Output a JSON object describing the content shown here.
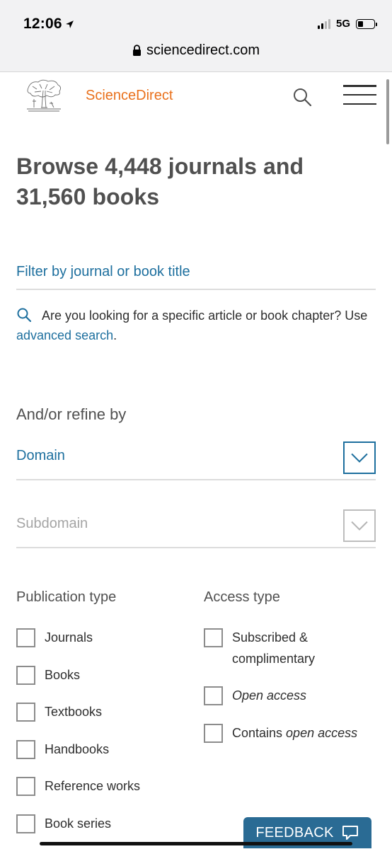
{
  "status_bar": {
    "time": "12:06",
    "network": "5G"
  },
  "browser": {
    "url": "sciencedirect.com"
  },
  "header": {
    "brand": "ScienceDirect"
  },
  "main": {
    "title": "Browse 4,448 journals and 31,560 books",
    "filter_placeholder": "Filter by journal or book title",
    "hint_text": "Are you looking for a specific article or book chapter? Use",
    "hint_link": "advanced search",
    "hint_end": ".",
    "refine_label": "And/or refine by",
    "domain_label": "Domain",
    "subdomain_label": "Subdomain"
  },
  "publication_type": {
    "heading": "Publication type",
    "options": [
      "Journals",
      "Books",
      "Textbooks",
      "Handbooks",
      "Reference works",
      "Book series"
    ]
  },
  "access_type": {
    "heading": "Access type",
    "options": [
      {
        "text": "Subscribed & complimentary"
      },
      {
        "text": "Open access",
        "italic": "true"
      },
      {
        "prefix": "Contains ",
        "italic_part": "open access"
      }
    ]
  },
  "feedback": {
    "label": "FEEDBACK"
  },
  "colors": {
    "brand": "#e9711c",
    "link": "#1d6f9e",
    "feedback_bg": "#2a6b94"
  }
}
